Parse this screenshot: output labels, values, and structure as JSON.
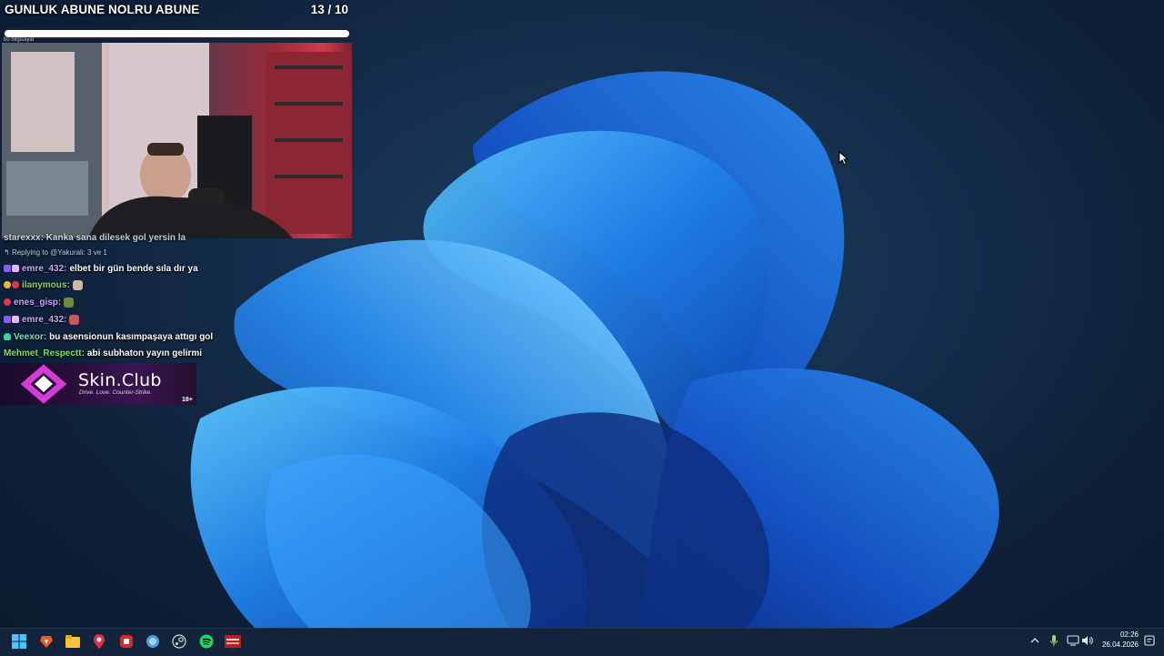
{
  "goal": {
    "title": "GUNLUK ABUNE NOLRU ABUNE",
    "count": "13 / 10",
    "progress": 1.0,
    "subtitle": "bu bilgisayar"
  },
  "chat": {
    "partial_line": "starexxx: Kanka sana dilesek gol yersin la",
    "reply_context": "Replying to @Yakurali: 3 ve 1",
    "messages": [
      {
        "user": "emre_432:",
        "text": "elbet bir gün bende sıla dır ya",
        "user_color": "#c9a7ff"
      },
      {
        "user": "ilanymous:",
        "text": "",
        "user_color": "#8fd46a"
      },
      {
        "user": "enes_gisp:",
        "text": "",
        "user_color": "#c9a7ff"
      },
      {
        "user": "emre_432:",
        "text": "",
        "user_color": "#c9a7ff"
      },
      {
        "user": "Veexor:",
        "text": "bu asensionun kasımpaşaya attıgı gol",
        "user_color": "#7ee0c4"
      },
      {
        "user": "Mehmet_Respectt:",
        "text": "abi subhaton yayın gelirmi",
        "user_color": "#7fe36a"
      }
    ]
  },
  "sponsor": {
    "name": "Skin.Club",
    "tagline": "Drive. Love. Counter-Strike.",
    "age": "18+",
    "accent": "#d63bd9"
  },
  "taskbar": {
    "apps": [
      "start-icon",
      "brave-icon",
      "file-explorer-icon",
      "map-pin-icon",
      "red-app-icon",
      "globe-icon",
      "steam-icon",
      "spotify-icon",
      "voicemeeter-icon"
    ],
    "clock_time": "02:26",
    "clock_date": "26.04.2026",
    "bg": "#12233a"
  },
  "colors": {
    "wallpaper_blue": "#1a6fe0",
    "wallpaper_light": "#3fb0ff"
  }
}
